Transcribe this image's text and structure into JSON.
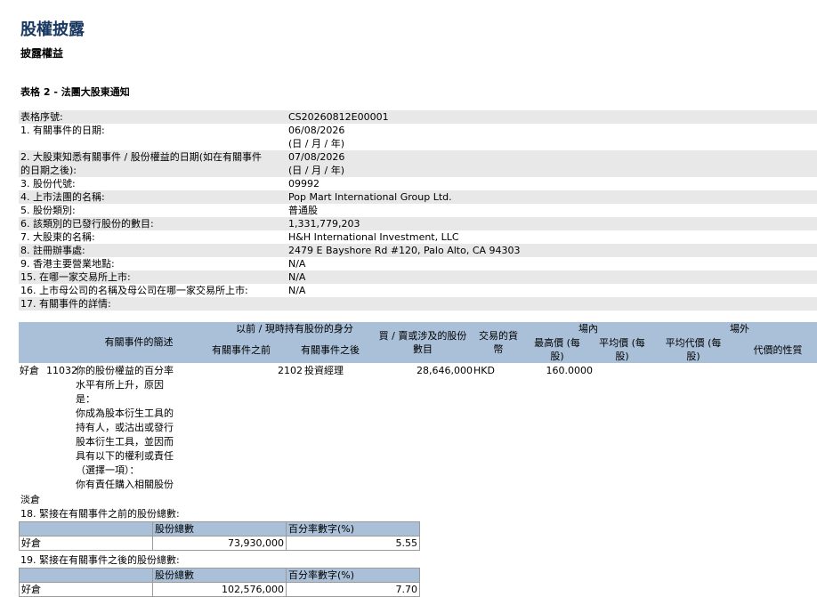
{
  "page": {
    "title": "股權披露",
    "subtitle": "披露權益",
    "form_title": "表格 2 - 法團大股東通知"
  },
  "rows": [
    {
      "label": "表格序號:",
      "value": "CS20260812E00001"
    },
    {
      "label": "1. 有關事件的日期:",
      "value": "06/08/2026",
      "value2": "(日 / 月 / 年)"
    },
    {
      "label": "2. 大股東知悉有關事件 / 股份權益的日期(如在有關事件",
      "label2": "的日期之後):",
      "value": "07/08/2026",
      "value2": "(日 / 月 / 年)"
    },
    {
      "label": "3. 股份代號:",
      "value": "09992"
    },
    {
      "label": "4. 上市法團的名稱:",
      "value": "Pop Mart International Group Ltd."
    },
    {
      "label": "5. 股份類別:",
      "value": "普通股"
    },
    {
      "label": "6. 該類別的已發行股份的數目:",
      "value": "1,331,779,203"
    },
    {
      "label": "7. 大股東的名稱:",
      "value": "H&H International Investment, LLC"
    },
    {
      "label": "8. 註冊辦事處:",
      "value": "2479 E Bayshore Rd #120, Palo Alto, CA 94303"
    },
    {
      "label": "9. 香港主要營業地點:",
      "value": "N/A"
    },
    {
      "label": "15. 在哪一家交易所上市:",
      "value": "N/A"
    },
    {
      "label": "16. 上市母公司的名稱及母公司在哪一家交易所上市:",
      "value": "N/A"
    },
    {
      "label": "17. 有關事件的詳情:",
      "value": ""
    }
  ],
  "detail_header": {
    "event_code": "有關事件的簡述",
    "capacity_group": "以前 / 現時持有股份的身分",
    "before": "有關事件之前",
    "after": "有關事件之後",
    "shares_l1": "買 / 賣或涉及的股份",
    "shares_l2": "數目",
    "currency_l1": "交易的貨",
    "currency_l2": "幣",
    "onex": "場內",
    "offex": "場外",
    "high_l1": "最高價 (每",
    "high_l2": "股)",
    "avg_l1": "平均價 (每",
    "avg_l2": "股)",
    "avgoff_l1": "平均代價 (每",
    "avgoff_l2": "股)",
    "nature": "代價的性質"
  },
  "detail_row": {
    "position": "好倉",
    "code": "11032",
    "desc": [
      "你的股份權益的百分率",
      "水平有所上升，原因",
      "是：",
      "你成為股本衍生工具的",
      "持有人，或沽出或發行",
      "股本衍生工具，並因而",
      "具有以下的權利或責任",
      "（選擇一項）：",
      "你有責任購入相關股份"
    ],
    "capacity_code": "2102",
    "capacity_label": "投資經理",
    "shares": "28,646,000",
    "currency": "HKD",
    "high": "160.0000"
  },
  "short_label": "淡倉",
  "s18": {
    "label": "18. 緊接在有關事件之前的股份總數:",
    "col1": "股份總數",
    "col2": "百分率數字(%)",
    "pos": "好倉",
    "shares": "73,930,000",
    "pct": "5.55"
  },
  "s19": {
    "label": "19. 緊接在有關事件之後的股份總數:",
    "col1": "股份總數",
    "col2": "百分率數字(%)",
    "pos": "好倉",
    "shares": "102,576,000",
    "pct": "7.70"
  }
}
